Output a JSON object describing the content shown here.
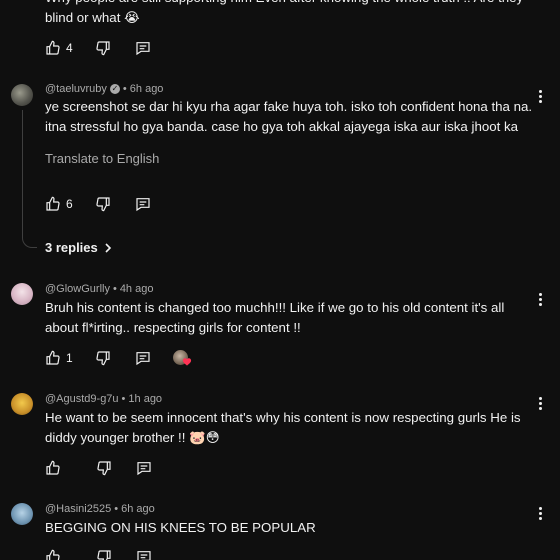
{
  "comments": [
    {
      "body": "Why people are still supporting him Even after knowing the whole truth !! Are they blind or what 😭",
      "likes": "4"
    },
    {
      "handle": "@taeluvruby",
      "time": "6h ago",
      "verified": true,
      "body": "ye screenshot se dar hi kyu rha agar fake huya toh. isko toh confident hona tha na. itna stressful ho gya banda. case ho gya toh akkal ajayega iska aur iska jhoot ka",
      "translate": "Translate to English",
      "likes": "6",
      "replies": "3 replies"
    },
    {
      "handle": "@GlowGurlly",
      "time": "4h ago",
      "body": "Bruh his content is changed too muchh!!! Like if we go to his old content it's all about fl*irting.. respecting girls for content !!",
      "likes": "1"
    },
    {
      "handle": "@Agustd9-g7u",
      "time": "1h ago",
      "body": "He want to be seem innocent that's why his content is now respecting gurls He is diddy younger brother !! 🐷😳",
      "likes": ""
    },
    {
      "handle": "@Hasini2525",
      "time": "6h ago",
      "body": "BEGGING ON HIS KNEES TO BE POPULAR",
      "likes": ""
    }
  ],
  "icons": {
    "like": "thumb-up-icon",
    "dislike": "thumb-down-icon",
    "reply": "reply-icon",
    "more": "more-vert-icon"
  },
  "colors": {
    "background": "#0f0f0f",
    "text": "#f1f1f1",
    "secondary": "#aaaaaa"
  }
}
